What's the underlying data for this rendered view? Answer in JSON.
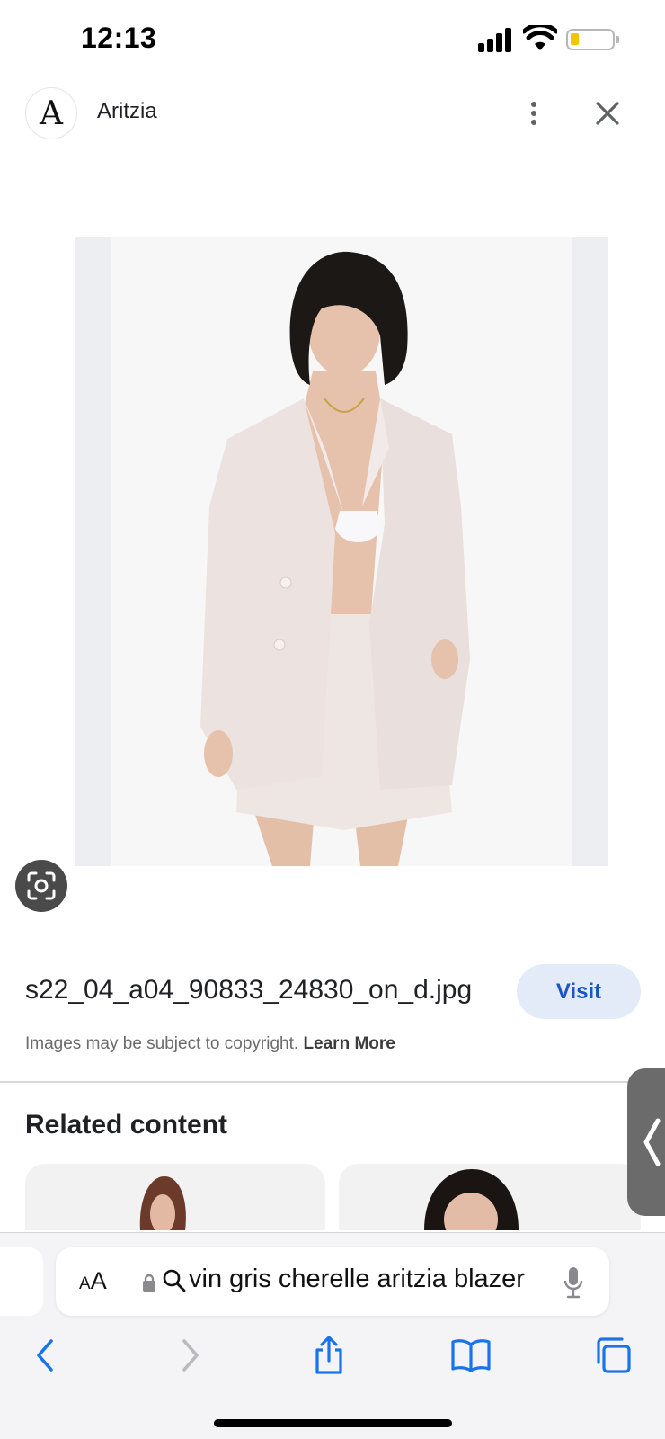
{
  "status_bar": {
    "time": "12:13",
    "battery_level": 0.15,
    "battery_color": "#f3c400"
  },
  "header": {
    "logo_letter": "A",
    "site_name": "Aritzia",
    "more_icon": "more-vert-icon",
    "close_icon": "close-icon"
  },
  "image": {
    "lens_icon": "google-lens-icon",
    "subject_colors": {
      "blazer": "#ece2e0",
      "hair": "#1c1816",
      "skin": "#e6c2ad"
    }
  },
  "info": {
    "filename": "s22_04_a04_90833_24830_on_d.jpg",
    "visit_label": "Visit",
    "copyright_text": "Images may be subject to copyright.",
    "learn_more_label": "Learn More",
    "accent": "#1a56c4"
  },
  "related": {
    "title": "Related content"
  },
  "browser": {
    "aa_label_small": "A",
    "aa_label_large": "A",
    "query": "vin gris cherelle aritzia blazer",
    "nav_icons": [
      "back-icon",
      "forward-icon",
      "share-icon",
      "bookmarks-icon",
      "tabs-icon"
    ],
    "tint": "#1a73e8"
  }
}
